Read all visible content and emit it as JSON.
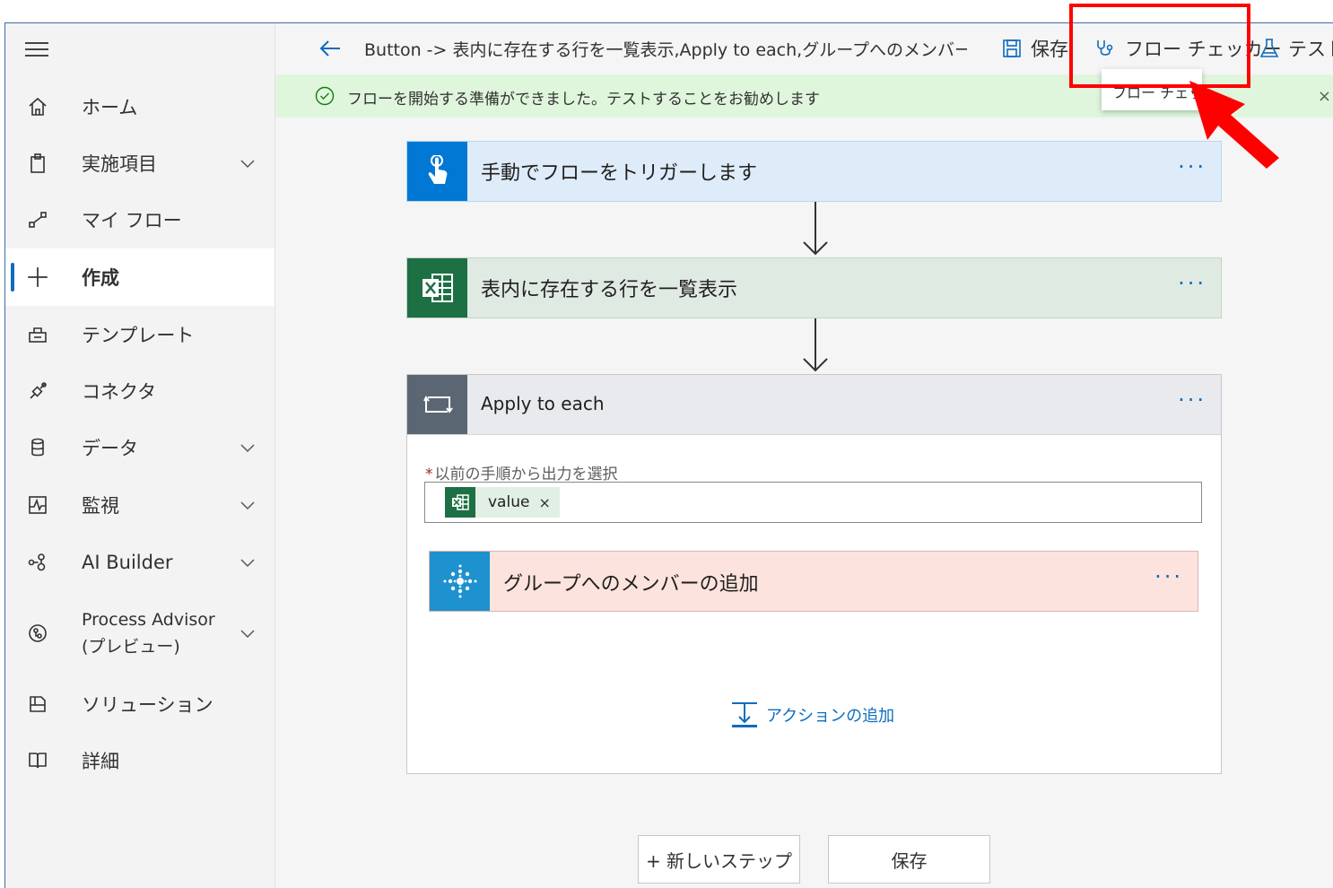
{
  "sidebar": {
    "items": [
      {
        "label": "ホーム",
        "icon": "home-icon",
        "chevron": false
      },
      {
        "label": "実施項目",
        "icon": "clipboard-icon",
        "chevron": true
      },
      {
        "label": "マイ フロー",
        "icon": "flow-icon",
        "chevron": false
      },
      {
        "label": "作成",
        "icon": "plus-icon",
        "chevron": false,
        "active": true
      },
      {
        "label": "テンプレート",
        "icon": "template-icon",
        "chevron": false
      },
      {
        "label": "コネクタ",
        "icon": "connector-icon",
        "chevron": false
      },
      {
        "label": "データ",
        "icon": "database-icon",
        "chevron": true
      },
      {
        "label": "監視",
        "icon": "monitor-icon",
        "chevron": true
      },
      {
        "label": "AI Builder",
        "icon": "ai-builder-icon",
        "chevron": true
      },
      {
        "label": "Process Advisor (プレビュー)",
        "icon": "process-advisor-icon",
        "chevron": true
      },
      {
        "label": "ソリューション",
        "icon": "solution-icon",
        "chevron": false
      },
      {
        "label": "詳細",
        "icon": "book-icon",
        "chevron": false
      }
    ]
  },
  "header": {
    "title": "Button -> 表内に存在する行を一覧表示,Apply to each,グループへのメンバーの",
    "save_label": "保存",
    "flow_checker_label": "フロー チェッカー",
    "test_label": "テスト"
  },
  "banner": {
    "text": "フローを開始する準備ができました。テストすることをお勧めします",
    "close": "×"
  },
  "tooltip": {
    "text": "フロー チェッカー"
  },
  "flow": {
    "trigger_label": "手動でフローをトリガーします",
    "excel_label": "表内に存在する行を一覧表示",
    "apply_label": "Apply to each",
    "field_label": "以前の手順から出力を選択",
    "required_mark": "*",
    "token_label": "value",
    "token_close": "×",
    "group_label": "グループへのメンバーの追加",
    "add_action_label": "アクションの追加",
    "more": "···"
  },
  "footer": {
    "new_step_label": "+ 新しいステップ",
    "save_label": "保存"
  },
  "colors": {
    "accent": "#0f6cbd",
    "trigger_bg": "#deecf9",
    "trigger_icon": "#0078d4",
    "excel_bg": "#dfeae2",
    "excel_icon": "#1d7044",
    "group_bg": "#fce3dd",
    "group_icon": "#1e91cf",
    "banner_bg": "#dff6dd",
    "annotation": "#ff0000"
  }
}
